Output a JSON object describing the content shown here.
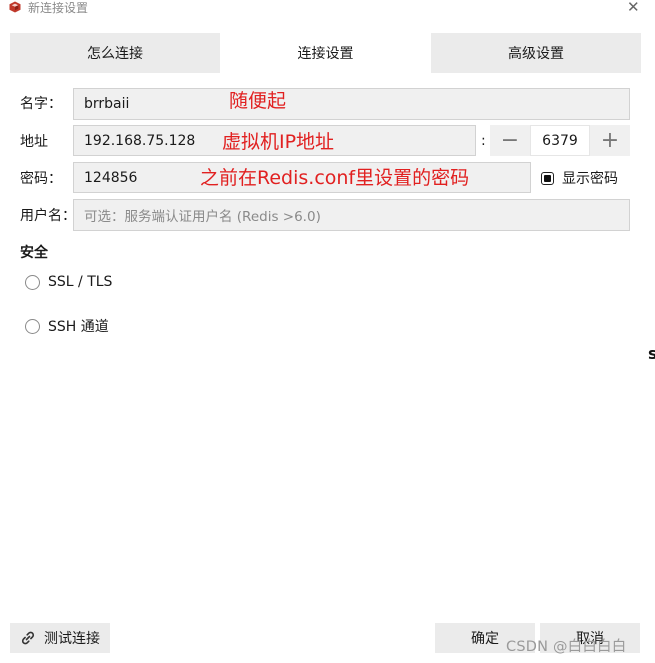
{
  "window": {
    "title": "新连接设置",
    "close_glyph": "✕"
  },
  "tabs": [
    {
      "label": "怎么连接",
      "active": false
    },
    {
      "label": "连接设置",
      "active": true
    },
    {
      "label": "高级设置",
      "active": false
    }
  ],
  "form": {
    "name": {
      "label": "名字：",
      "value": "brrbaii"
    },
    "address": {
      "label": "地址",
      "value": "192.168.75.128"
    },
    "port": {
      "colon": ":",
      "decrement": "−",
      "value": "6379",
      "increment": "+"
    },
    "password": {
      "label": "密码：",
      "value": "124856"
    },
    "show_password": {
      "label": "显示密码",
      "checked": true
    },
    "username": {
      "label": "用户名：",
      "placeholder": "可选：服务端认证用户名 (Redis >6.0)"
    }
  },
  "annotations": {
    "name_note": "随便起",
    "address_note": "虚拟机IP地址",
    "password_note": "之前在Redis.conf里设置的密码"
  },
  "security": {
    "title": "安全",
    "options": [
      {
        "label": "SSL / TLS",
        "checked": false
      },
      {
        "label": "SSH 通道",
        "checked": false
      }
    ]
  },
  "buttons": {
    "test": "测试连接",
    "ok": "确定",
    "cancel": "取消"
  },
  "watermark": "CSDN @白白白白",
  "edge_glyph": "s",
  "colors": {
    "annotation": "#e12020",
    "app_icon": "#c0392b",
    "tab_inactive": "#ebebeb",
    "field_bg": "#f0f0f0"
  },
  "icons": {
    "app": "redis-cube-icon",
    "close": "close-icon",
    "test": "link-icon"
  }
}
